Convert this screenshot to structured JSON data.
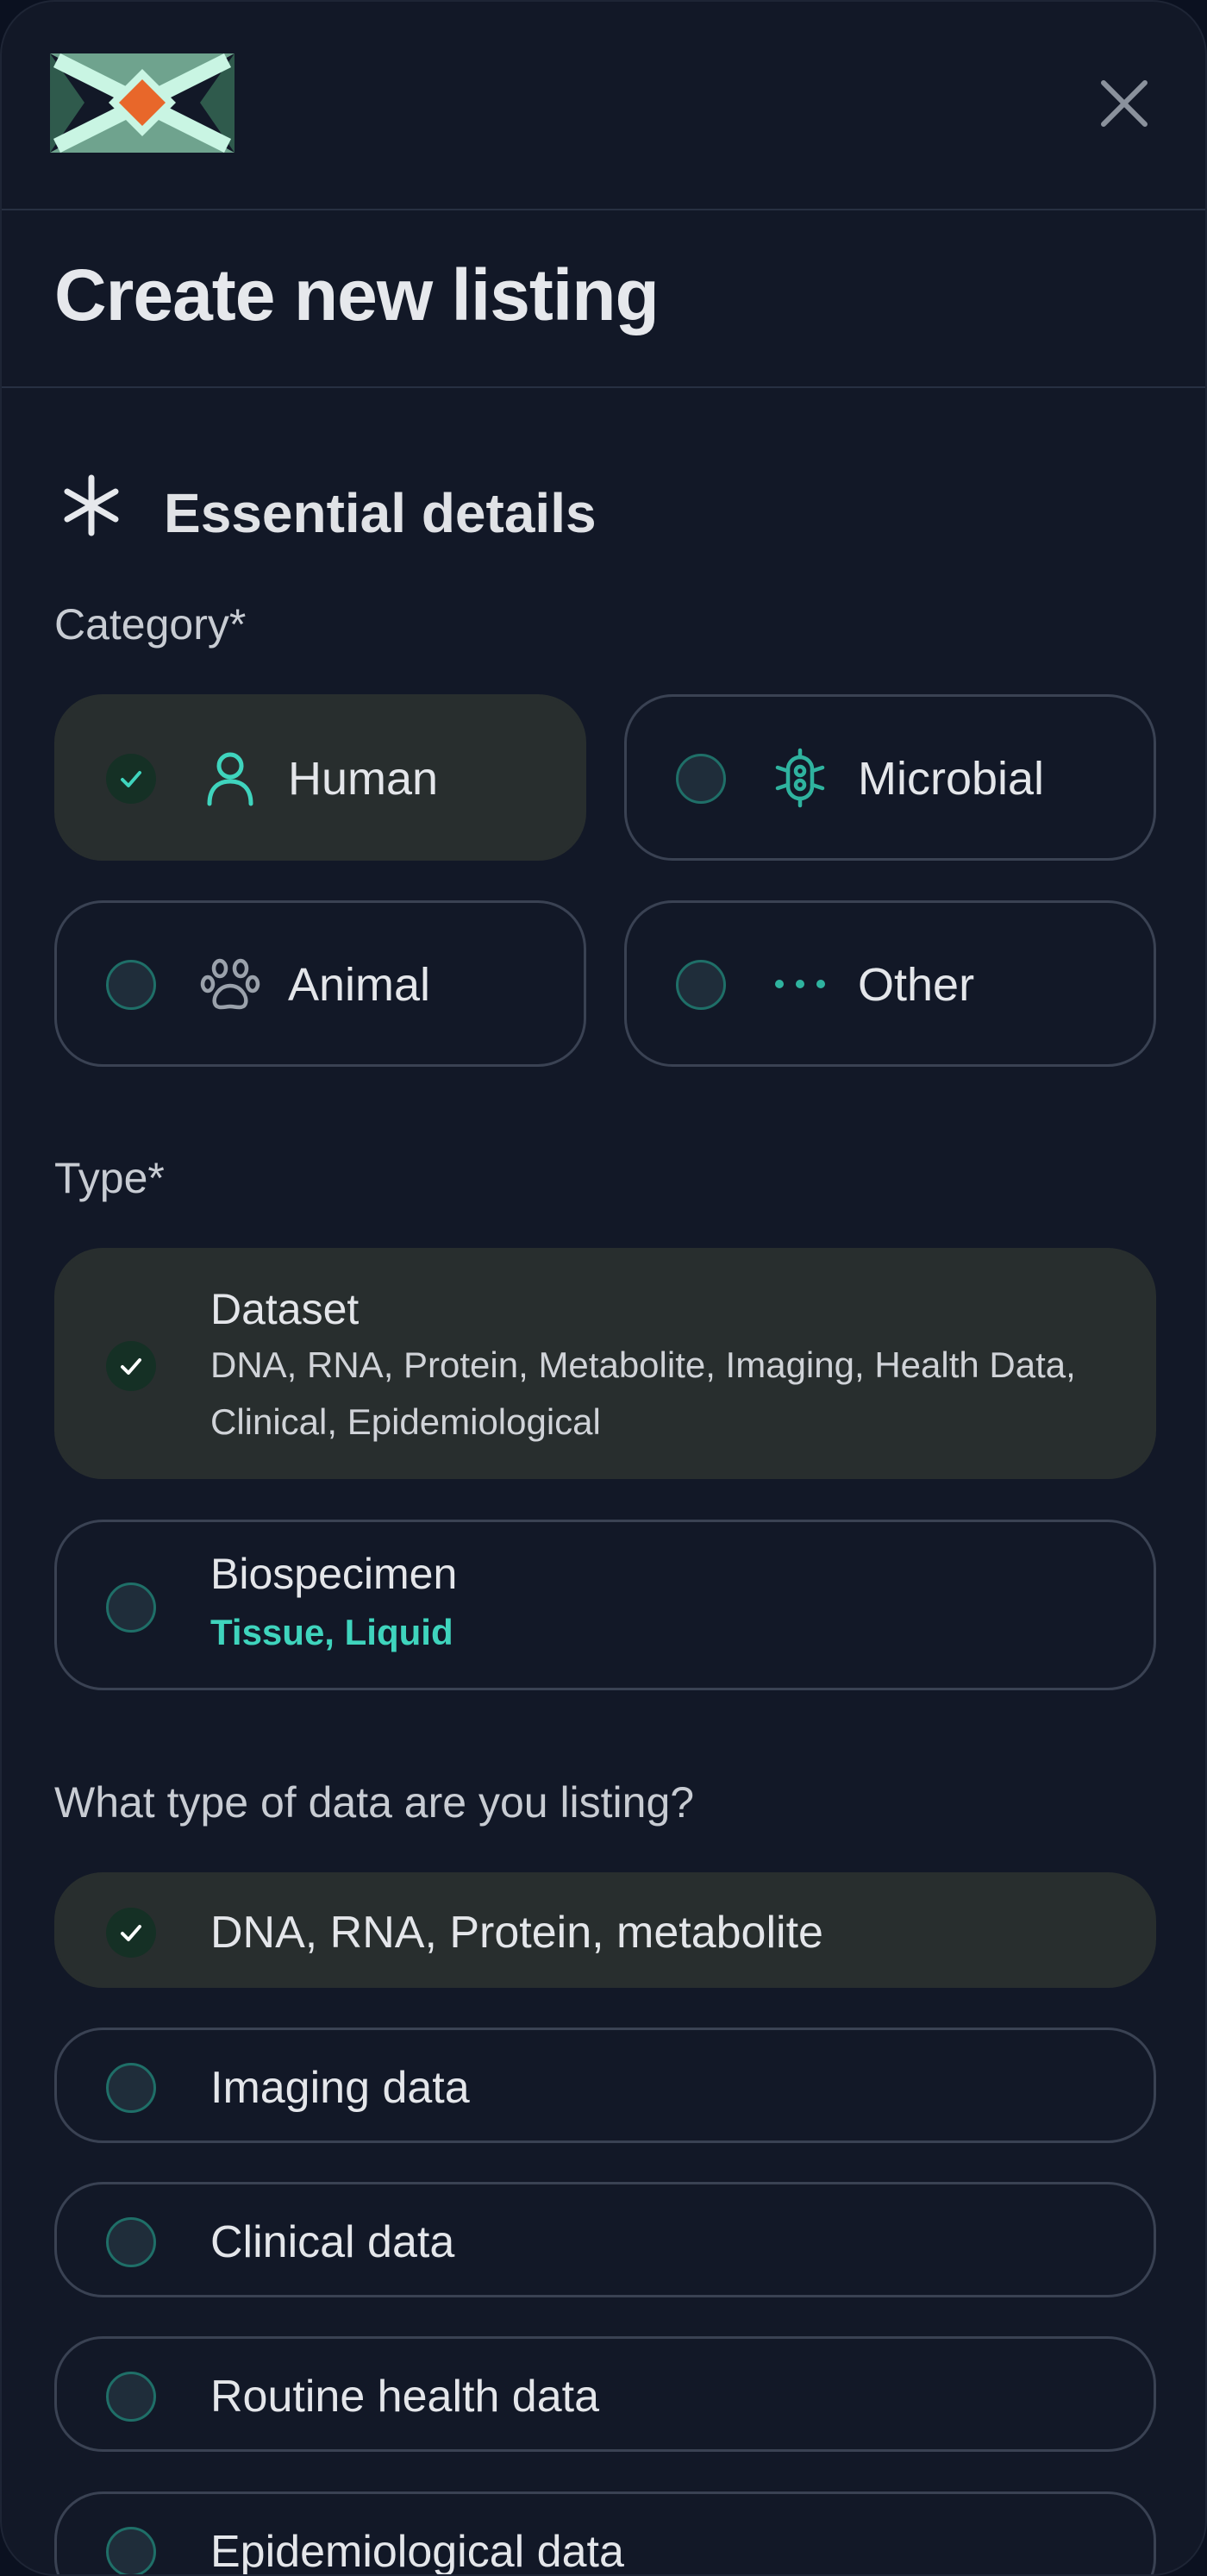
{
  "header": {
    "logo_icon": "diamond-x-logo",
    "close_icon": "close-icon"
  },
  "page": {
    "title": "Create new listing"
  },
  "section": {
    "title": "Essential details",
    "icon": "asterisk-icon"
  },
  "category": {
    "label": "Category*",
    "options": [
      {
        "label": "Human",
        "icon": "person-icon",
        "selected": true
      },
      {
        "label": "Microbial",
        "icon": "microbe-icon",
        "selected": false
      },
      {
        "label": "Animal",
        "icon": "paw-icon",
        "selected": false
      },
      {
        "label": "Other",
        "icon": "more-dots-icon",
        "selected": false
      }
    ]
  },
  "type": {
    "label": "Type*",
    "options": [
      {
        "title": "Dataset",
        "description": "DNA, RNA, Protein, Metabolite, Imaging, Health Data, Clinical, Epidemiological",
        "selected": true
      },
      {
        "title": "Biospecimen",
        "description": "Tissue, Liquid",
        "selected": false
      }
    ]
  },
  "data_type": {
    "label": "What type of data are you listing?",
    "options": [
      {
        "label": "DNA, RNA, Protein, metabolite",
        "selected": true
      },
      {
        "label": "Imaging data",
        "selected": false
      },
      {
        "label": "Clinical data",
        "selected": false
      },
      {
        "label": "Routine health data",
        "selected": false
      },
      {
        "label": "Epidemiological data",
        "selected": false
      }
    ]
  },
  "colors": {
    "background": "#121827",
    "selected_card": "#282e2e",
    "accent": "#3fd4bd",
    "logo_orange": "#e8672a",
    "logo_mint": "#c9f5e3"
  }
}
